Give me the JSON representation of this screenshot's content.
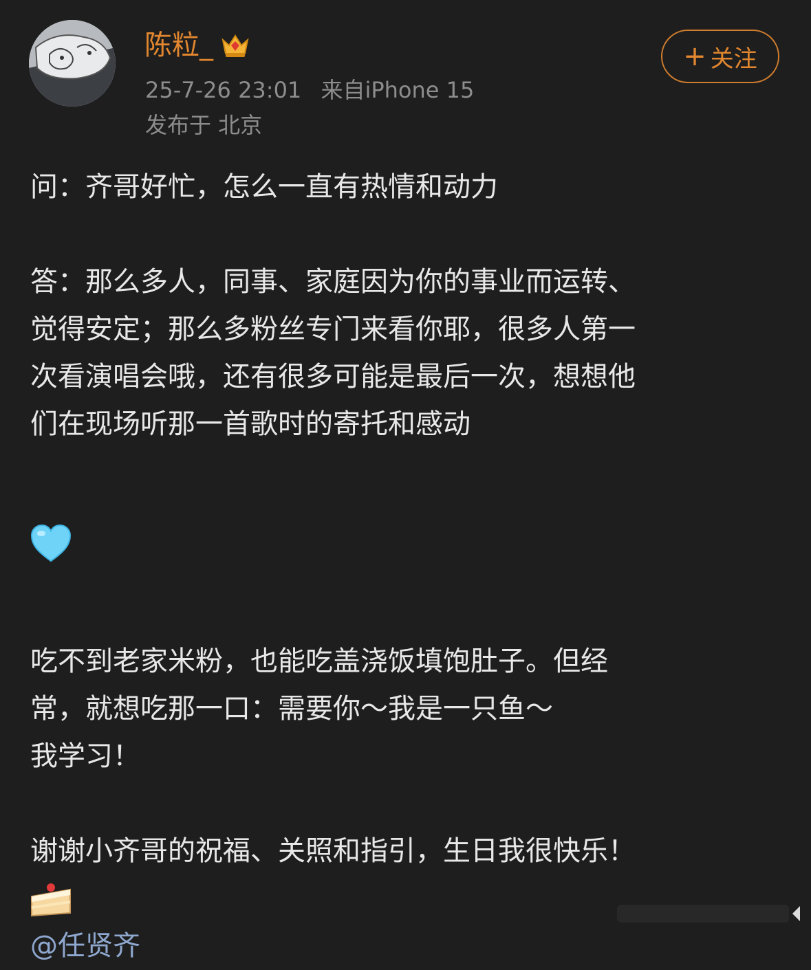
{
  "author": {
    "name": "陈粒_",
    "badge_icon": "crown-badge-icon"
  },
  "meta": {
    "time": "25-7-26 23:01",
    "source": "来自iPhone 15",
    "location": "发布于 北京"
  },
  "follow_button": {
    "plus": "+",
    "label": "关注"
  },
  "post": {
    "question": "问：齐哥好忙，怎么一直有热情和动力",
    "answer_lines": [
      "答：那么多人，同事、家庭因为你的事业而运转、",
      "觉得安定；那么多粉丝专门来看你耶，很多人第一",
      "次看演唱会哦，还有很多可能是最后一次，想想他",
      "们在现场听那一首歌时的寄托和感动"
    ],
    "heart_icon": "light-blue-heart-icon",
    "paragraph2_lines": [
      "吃不到老家米粉，也能吃盖浇饭填饱肚子。但经",
      "常，就想吃那一口：需要你～我是一只鱼～",
      "我学习！"
    ],
    "thanks_line": "谢谢小齐哥的祝福、关照和指引，生日我很快乐！",
    "cake_icon": "cake-slice-icon",
    "mention": "@任贤齐"
  },
  "colors": {
    "background": "#1e1e1e",
    "accent": "#e2872f",
    "meta_text": "#8d8d8d",
    "mention": "#8fa8cf"
  }
}
